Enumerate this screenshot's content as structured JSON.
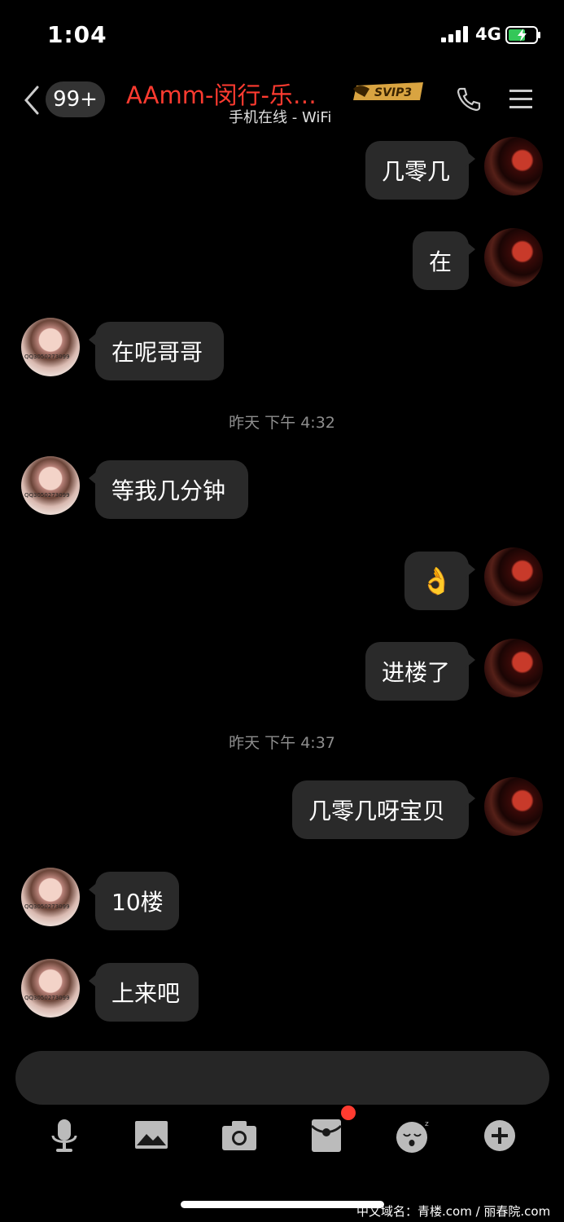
{
  "status": {
    "time": "1:04",
    "network": "4G"
  },
  "header": {
    "badge": "99+",
    "title": "AAmm-闵行-乐…",
    "svip_label": "SVIP3",
    "subtitle": "手机在线 - WiFi",
    "svip_color": "#d9a441",
    "title_color": "#ff3b30"
  },
  "messages": [
    {
      "side": "right",
      "text": "几零几"
    },
    {
      "side": "right",
      "text": "在"
    },
    {
      "side": "left",
      "text": "在呢哥哥"
    },
    {
      "side": "time",
      "text": "昨天 下午 4:32"
    },
    {
      "side": "left",
      "text": "等我几分钟"
    },
    {
      "side": "right",
      "text": "👌"
    },
    {
      "side": "right",
      "text": "进楼了"
    },
    {
      "side": "time",
      "text": "昨天 下午 4:37"
    },
    {
      "side": "right",
      "text": "几零几呀宝贝"
    },
    {
      "side": "left",
      "text": "10楼"
    },
    {
      "side": "left",
      "text": "上来吧"
    }
  ],
  "avatar_caption": "QQ3050273099",
  "toolbar": [
    "microphone-icon",
    "image-icon",
    "camera-icon",
    "red-packet-icon",
    "sticker-icon",
    "plus-icon"
  ],
  "watermark": "中文域名：青楼.com / 丽春院.com"
}
